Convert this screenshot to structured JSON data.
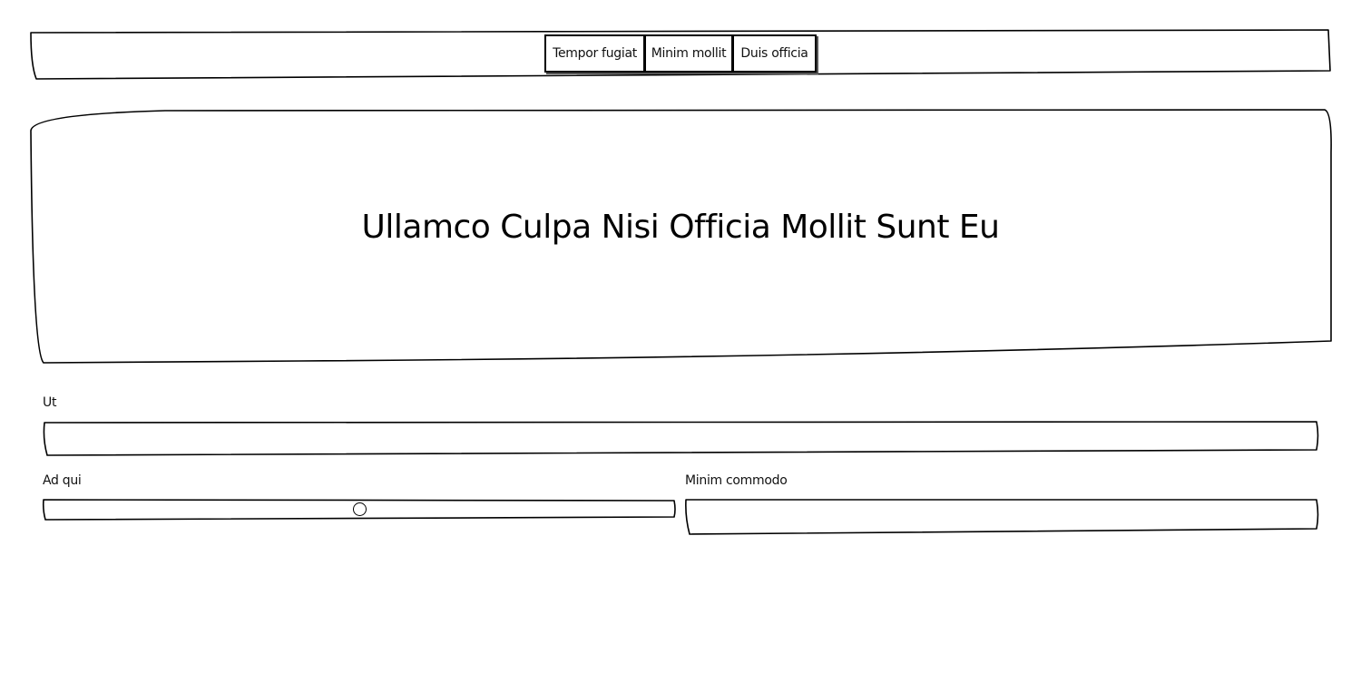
{
  "nav": {
    "items": [
      {
        "label": "Tempor fugiat"
      },
      {
        "label": "Minim mollit"
      },
      {
        "label": "Duis officia"
      }
    ]
  },
  "hero": {
    "title": "Ullamco Culpa Nisi Officia Mollit Sunt Eu"
  },
  "form": {
    "ut": {
      "label": "Ut",
      "value": "",
      "placeholder": ""
    },
    "ad_qui": {
      "label": "Ad qui",
      "value": 0.5
    },
    "minim_commodo": {
      "label": "Minim commodo",
      "value": "",
      "placeholder": ""
    }
  }
}
